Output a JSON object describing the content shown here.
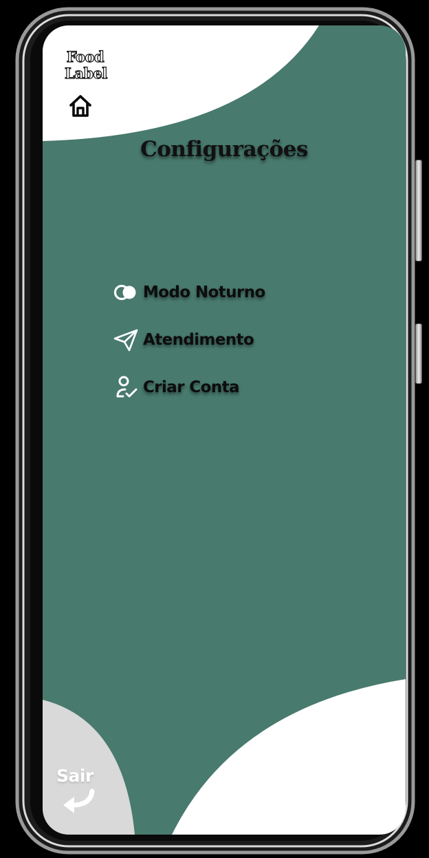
{
  "brand": {
    "logo_line1": "Food",
    "logo_line2": "Label"
  },
  "header": {
    "home_icon": "home-icon",
    "title": "Configurações"
  },
  "menu": {
    "items": [
      {
        "label": "Modo Noturno",
        "icon": "night-mode-icon"
      },
      {
        "label": "Atendimento",
        "icon": "paper-plane-icon"
      },
      {
        "label": "Criar Conta",
        "icon": "user-check-icon"
      }
    ]
  },
  "footer": {
    "exit_label": "Sair",
    "exit_icon": "back-arrow-icon"
  },
  "colors": {
    "background_green": "#487a6d",
    "accent_white": "#ffffff",
    "exit_gray": "#d9d9d9",
    "text_dark": "#111111"
  }
}
